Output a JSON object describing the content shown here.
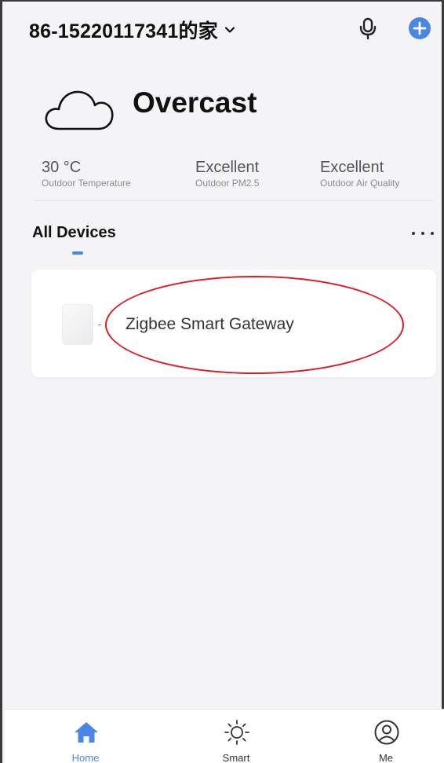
{
  "header": {
    "home_name": "86-15220117341的家",
    "icons": {
      "dropdown": "chevron-down-icon",
      "voice": "microphone-icon",
      "add": "plus-circle-icon"
    },
    "accent_color": "#4a86e8"
  },
  "weather": {
    "condition": "Overcast",
    "icon": "cloud-icon",
    "stats": [
      {
        "value": "30 °C",
        "label": "Outdoor Temperature"
      },
      {
        "value": "Excellent",
        "label": "Outdoor PM2.5"
      },
      {
        "value": "Excellent",
        "label": "Outdoor Air Quality"
      }
    ]
  },
  "devices_section": {
    "tab_label": "All Devices",
    "more_icon": "more-horizontal-icon",
    "devices": [
      {
        "name": "Zigbee Smart Gateway",
        "icon": "gateway-device-icon"
      }
    ],
    "annotation_color": "#e11a22"
  },
  "bottom_nav": {
    "items": [
      {
        "label": "Home",
        "icon": "home-icon",
        "active": true
      },
      {
        "label": "Smart",
        "icon": "sun-icon",
        "active": false
      },
      {
        "label": "Me",
        "icon": "user-circle-icon",
        "active": false
      }
    ]
  }
}
